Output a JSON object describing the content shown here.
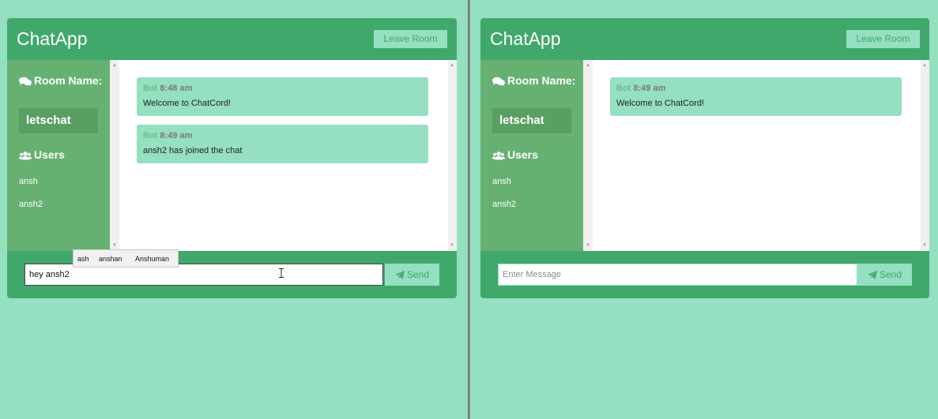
{
  "left_window": {
    "app_title": "ChatApp",
    "leave_label": "Leave Room",
    "room_heading": "Room Name:",
    "room_name": "letschat",
    "users_heading": "Users",
    "users": [
      "ansh",
      "ansh2"
    ],
    "messages": [
      {
        "user": "Bot",
        "time": "8:48 am",
        "text": "Welcome to ChatCord!"
      },
      {
        "user": "Bot",
        "time": "8:49 am",
        "text": "ansh2 has joined the chat"
      }
    ],
    "input_value": "hey ansh2",
    "send_label": "Send",
    "autocomplete": [
      "ash",
      "anshan",
      "Anshuman"
    ]
  },
  "right_window": {
    "app_title": "ChatApp",
    "leave_label": "Leave Room",
    "room_heading": "Room Name:",
    "room_name": "letschat",
    "users_heading": "Users",
    "users": [
      "ansh",
      "ansh2"
    ],
    "messages": [
      {
        "user": "Bot",
        "time": "8:49 am",
        "text": "Welcome to ChatCord!"
      }
    ],
    "input_placeholder": "Enter Message",
    "send_label": "Send"
  },
  "colors": {
    "page_bg": "#94e0c0",
    "header": "#41a86c",
    "sidebar": "#66b172",
    "room_box": "#5a9f62",
    "message_bg": "#94e0c0"
  },
  "icons": {
    "room": "comments-icon",
    "users": "users-icon",
    "send": "paper-plane-icon"
  }
}
